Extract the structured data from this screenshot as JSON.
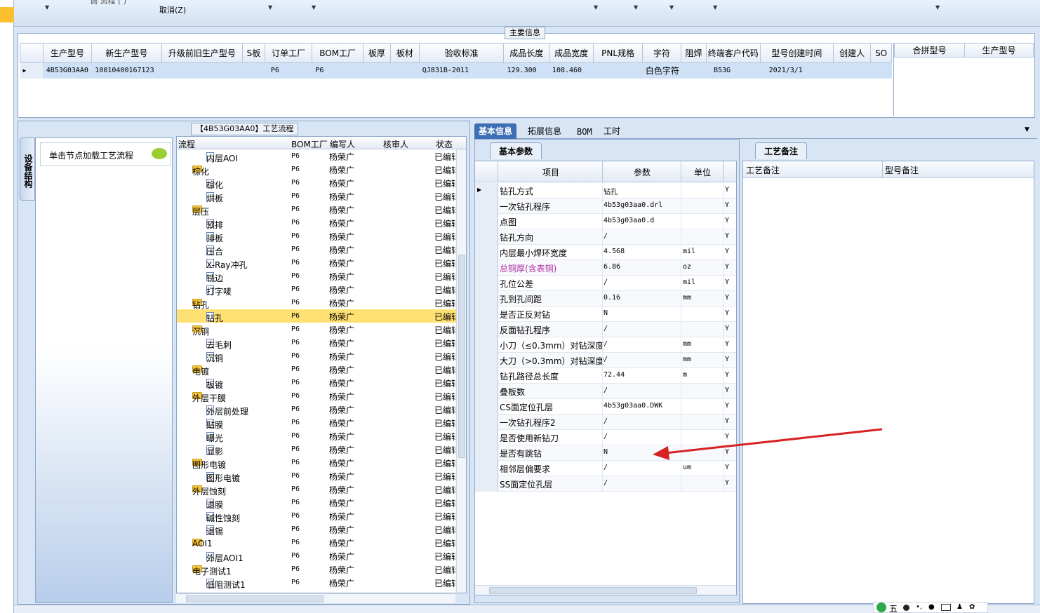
{
  "toolbar": {
    "cancel_label": "取消(Z)",
    "ghost_text": "调 流程   (        )"
  },
  "main_info": {
    "title": "主要信息",
    "columns": [
      "生产型号",
      "新生产型号",
      "升级前旧生产型号",
      "S板",
      "订单工厂",
      "BOM工厂",
      "板厚",
      "板材",
      "验收标准",
      "成品长度",
      "成品宽度",
      "PNL规格",
      "字符",
      "阻焊",
      "终端客户代码",
      "型号创建时间",
      "创建人",
      "SO"
    ],
    "row": [
      "4B53G03AA0",
      "10010400167123",
      "",
      "",
      "P6",
      "P6",
      "",
      "",
      "QJ831B-2011",
      "129.300",
      "108.460",
      "",
      "白色字符",
      "",
      "B53G",
      "2021/3/1",
      "",
      ""
    ]
  },
  "combine": {
    "columns": [
      "合拼型号",
      "生产型号"
    ]
  },
  "left_panel": {
    "tab_label": "设备结构",
    "hint": "单击节点加载工艺流程"
  },
  "process": {
    "title": "【4B53G03AA0】工艺流程",
    "columns": [
      "流程",
      "BOM工厂",
      "编写人",
      "核审人",
      "状态"
    ],
    "rows": [
      {
        "type": "child",
        "name": "内层AOI",
        "bom": "P6",
        "writer": "杨荣广",
        "reviewer": "",
        "status": "已编辑"
      },
      {
        "type": "folder",
        "name": "棕化",
        "bom": "P6",
        "writer": "杨荣广",
        "reviewer": "",
        "status": "已编辑"
      },
      {
        "type": "child",
        "name": "棕化",
        "bom": "P6",
        "writer": "杨荣广",
        "reviewer": "",
        "status": "已编辑"
      },
      {
        "type": "child",
        "name": "烘板",
        "bom": "P6",
        "writer": "杨荣广",
        "reviewer": "",
        "status": "已编辑"
      },
      {
        "type": "folder",
        "name": "层压",
        "bom": "P6",
        "writer": "杨荣广",
        "reviewer": "",
        "status": "已编辑"
      },
      {
        "type": "child",
        "name": "预排",
        "bom": "P6",
        "writer": "杨荣广",
        "reviewer": "",
        "status": "已编辑"
      },
      {
        "type": "child",
        "name": "排板",
        "bom": "P6",
        "writer": "杨荣广",
        "reviewer": "",
        "status": "已编辑"
      },
      {
        "type": "child",
        "name": "压合",
        "bom": "P6",
        "writer": "杨荣广",
        "reviewer": "",
        "status": "已编辑"
      },
      {
        "type": "child",
        "name": "X-Ray冲孔",
        "bom": "P6",
        "writer": "杨荣广",
        "reviewer": "",
        "status": "已编辑"
      },
      {
        "type": "child",
        "name": "铣边",
        "bom": "P6",
        "writer": "杨荣广",
        "reviewer": "",
        "status": "已编辑"
      },
      {
        "type": "child",
        "name": "打字唛",
        "bom": "P6",
        "writer": "杨荣广",
        "reviewer": "",
        "status": "已编辑"
      },
      {
        "type": "folder",
        "name": "钻孔",
        "bom": "P6",
        "writer": "杨荣广",
        "reviewer": "",
        "status": "已编辑"
      },
      {
        "type": "child",
        "name": "钻孔",
        "bom": "P6",
        "writer": "杨荣广",
        "reviewer": "",
        "status": "已编辑",
        "selected": true
      },
      {
        "type": "folder",
        "name": "沉铜",
        "bom": "P6",
        "writer": "杨荣广",
        "reviewer": "",
        "status": "已编辑"
      },
      {
        "type": "child",
        "name": "去毛刺",
        "bom": "P6",
        "writer": "杨荣广",
        "reviewer": "",
        "status": "已编辑"
      },
      {
        "type": "child",
        "name": "沉铜",
        "bom": "P6",
        "writer": "杨荣广",
        "reviewer": "",
        "status": "已编辑"
      },
      {
        "type": "folder",
        "name": "电镀",
        "bom": "P6",
        "writer": "杨荣广",
        "reviewer": "",
        "status": "已编辑"
      },
      {
        "type": "child",
        "name": "板镀",
        "bom": "P6",
        "writer": "杨荣广",
        "reviewer": "",
        "status": "已编辑"
      },
      {
        "type": "folder",
        "name": "外层干膜",
        "bom": "P6",
        "writer": "杨荣广",
        "reviewer": "",
        "status": "已编辑"
      },
      {
        "type": "child",
        "name": "外层前处理",
        "bom": "P6",
        "writer": "杨荣广",
        "reviewer": "",
        "status": "已编辑"
      },
      {
        "type": "child",
        "name": "贴膜",
        "bom": "P6",
        "writer": "杨荣广",
        "reviewer": "",
        "status": "已编辑"
      },
      {
        "type": "child",
        "name": "曝光",
        "bom": "P6",
        "writer": "杨荣广",
        "reviewer": "",
        "status": "已编辑"
      },
      {
        "type": "child",
        "name": "显影",
        "bom": "P6",
        "writer": "杨荣广",
        "reviewer": "",
        "status": "已编辑"
      },
      {
        "type": "folder",
        "name": "图形电镀",
        "bom": "P6",
        "writer": "杨荣广",
        "reviewer": "",
        "status": "已编辑"
      },
      {
        "type": "child",
        "name": "图形电镀",
        "bom": "P6",
        "writer": "杨荣广",
        "reviewer": "",
        "status": "已编辑"
      },
      {
        "type": "folder",
        "name": "外层蚀刻",
        "bom": "P6",
        "writer": "杨荣广",
        "reviewer": "",
        "status": "已编辑"
      },
      {
        "type": "child",
        "name": "退膜",
        "bom": "P6",
        "writer": "杨荣广",
        "reviewer": "",
        "status": "已编辑"
      },
      {
        "type": "child",
        "name": "碱性蚀刻",
        "bom": "P6",
        "writer": "杨荣广",
        "reviewer": "",
        "status": "已编辑"
      },
      {
        "type": "child",
        "name": "退锡",
        "bom": "P6",
        "writer": "杨荣广",
        "reviewer": "",
        "status": "已编辑"
      },
      {
        "type": "folder",
        "name": "AOI1",
        "bom": "P6",
        "writer": "杨荣广",
        "reviewer": "",
        "status": "已编辑"
      },
      {
        "type": "child",
        "name": "外层AOI1",
        "bom": "P6",
        "writer": "杨荣广",
        "reviewer": "",
        "status": "已编辑"
      },
      {
        "type": "folder",
        "name": "电子测试1",
        "bom": "P6",
        "writer": "杨荣广",
        "reviewer": "",
        "status": "已编辑"
      },
      {
        "type": "child",
        "name": "低阻测试1",
        "bom": "P6",
        "writer": "杨荣广",
        "reviewer": "",
        "status": "已编辑"
      }
    ]
  },
  "tabs": {
    "basic": "基本信息",
    "ext": "拓展信息",
    "bom": "BOM",
    "hours": "工时"
  },
  "params": {
    "subtab": "基本参数",
    "columns": [
      "项目",
      "参数",
      "单位"
    ],
    "rows": [
      {
        "name": "钻孔方式",
        "value": "钻孔",
        "unit": "",
        "flag": "Y"
      },
      {
        "name": "一次钻孔程序",
        "value": "4b53g03aa0.drl",
        "unit": "",
        "flag": "Y"
      },
      {
        "name": "点图",
        "value": "4b53g03aa0.d",
        "unit": "",
        "flag": "Y"
      },
      {
        "name": "钻孔方向",
        "value": "/",
        "unit": "",
        "flag": "Y"
      },
      {
        "name": "内层最小焊环宽度",
        "value": "4.568",
        "unit": "mil",
        "flag": "Y"
      },
      {
        "name": "总铜厚(含表铜)",
        "value": "6.86",
        "unit": "oz",
        "flag": "Y",
        "highlight": true
      },
      {
        "name": "孔位公差",
        "value": "/",
        "unit": "mil",
        "flag": "Y"
      },
      {
        "name": "孔到孔间距",
        "value": "0.16",
        "unit": "mm",
        "flag": "Y"
      },
      {
        "name": "是否正反对钻",
        "value": "N",
        "unit": "",
        "flag": "Y"
      },
      {
        "name": "反面钻孔程序",
        "value": "/",
        "unit": "",
        "flag": "Y"
      },
      {
        "name": "小刀（≤0.3mm）对钻深度",
        "value": "/",
        "unit": "mm",
        "flag": "Y"
      },
      {
        "name": "大刀（>0.3mm）对钻深度",
        "value": "/",
        "unit": "mm",
        "flag": "Y"
      },
      {
        "name": "钻孔路径总长度",
        "value": "72.44",
        "unit": "m",
        "flag": "Y"
      },
      {
        "name": "叠板数",
        "value": "/",
        "unit": "",
        "flag": "Y"
      },
      {
        "name": "CS面定位孔层",
        "value": "4b53g03aa0.DWK",
        "unit": "",
        "flag": "Y"
      },
      {
        "name": "一次钻孔程序2",
        "value": "/",
        "unit": "",
        "flag": "Y"
      },
      {
        "name": "是否使用新钻刀",
        "value": "/",
        "unit": "",
        "flag": "Y"
      },
      {
        "name": "是否有跳钻",
        "value": "N",
        "unit": "",
        "flag": "Y"
      },
      {
        "name": "相邻层偏要求",
        "value": "/",
        "unit": "um",
        "flag": "Y"
      },
      {
        "name": "SS面定位孔层",
        "value": "/",
        "unit": "",
        "flag": "Y"
      }
    ]
  },
  "notes": {
    "subtab": "工艺备注",
    "columns": [
      "工艺备注",
      "型号备注"
    ]
  },
  "tray": {
    "text": "五"
  },
  "colors": {
    "selected_tree": "#ffe173",
    "active_tab": "#3c6fb4",
    "highlight_text": "#b02ea3",
    "arrow": "#d62222"
  }
}
